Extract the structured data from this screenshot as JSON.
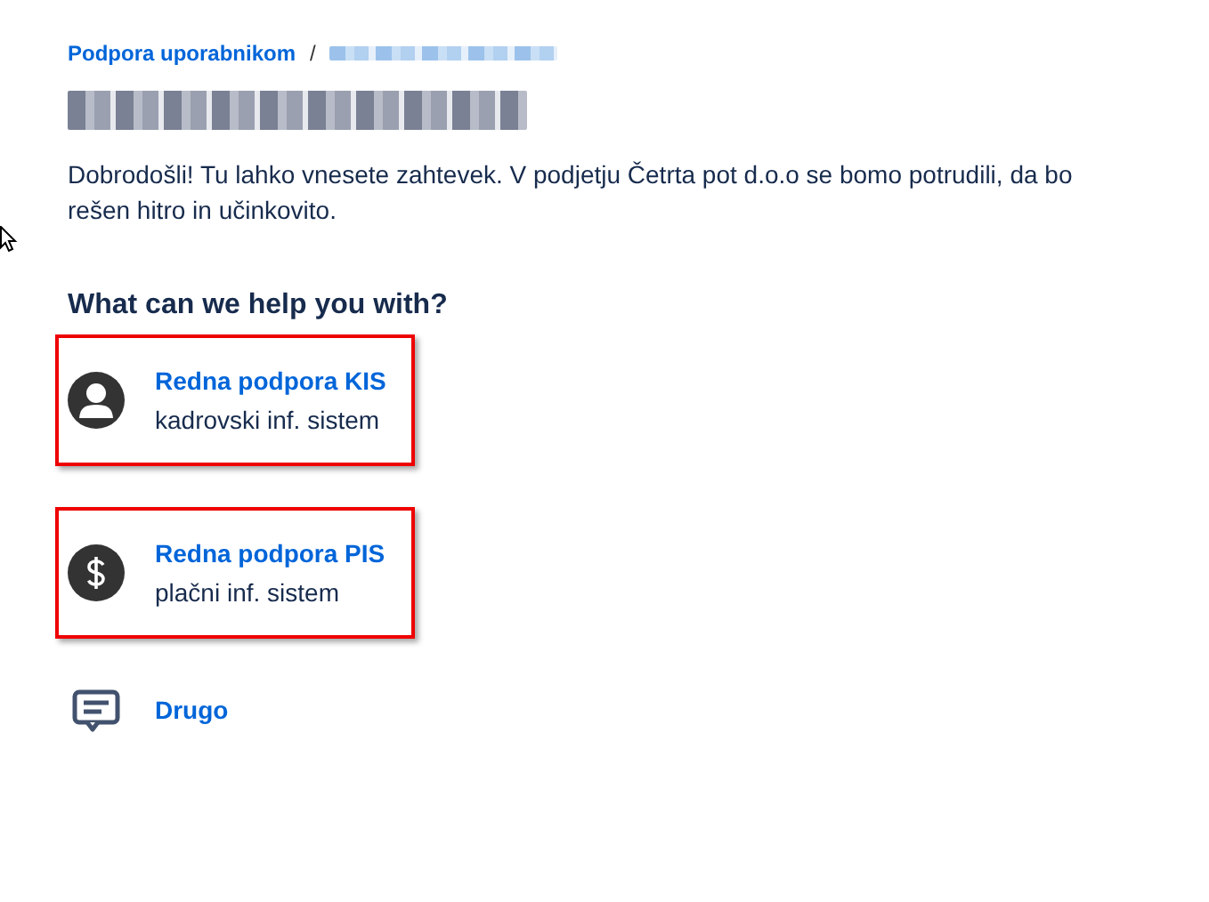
{
  "breadcrumb": [
    {
      "label": "Podpora uporabnikom",
      "redacted": false
    },
    {
      "redacted": true
    }
  ],
  "breadcrumb_separator": "/",
  "title": {
    "redacted": true
  },
  "intro": "Dobrodošli! Tu lahko vnesete zahtevek. V podjetju Četrta pot d.o.o se bomo potrudili, da bo rešen hitro in učinkovito.",
  "heading": "What can we help you with?",
  "options": [
    {
      "kind": "person",
      "title": "Redna podpora KIS",
      "description": "kadrovski inf. sistem",
      "highlighted": true
    },
    {
      "kind": "dollar",
      "title": "Redna podpora PIS",
      "description": "plačni inf. sistem",
      "highlighted": true
    },
    {
      "kind": "comment",
      "title": "Drugo",
      "highlighted": false
    }
  ]
}
